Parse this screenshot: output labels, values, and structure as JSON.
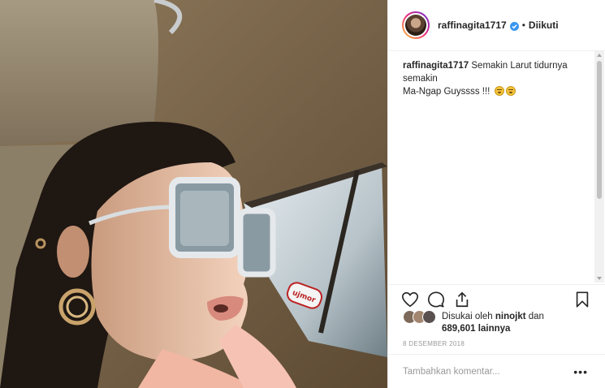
{
  "post": {
    "username": "raffinagita1717",
    "follow_status": "Diikuti",
    "separator": "•",
    "caption_user": "raffinagita1717",
    "caption_line1": "Semakin Larut tidurnya semakin",
    "caption_line2": "Ma-Ngap Guyssss !!!",
    "liked_by_prefix": "Disukai oleh",
    "liked_by_user": "ninojkt",
    "liked_by_suffix": "dan",
    "likes_count": "689,601",
    "likes_count_suffix": "lainnya",
    "date": "8 DESEMBER 2018",
    "comment_placeholder": "Tambahkan komentar...",
    "more_options": "•••",
    "sticker_text": "ujmor"
  },
  "icons": {
    "verified": "verified-badge-icon",
    "like": "heart-icon",
    "comment": "comment-icon",
    "share": "share-icon",
    "save": "bookmark-icon",
    "emoji": "laughing-emoji-icon"
  },
  "colors": {
    "verified_blue": "#3897f0",
    "border": "#efefef",
    "muted_text": "#999999",
    "text": "#262626"
  }
}
